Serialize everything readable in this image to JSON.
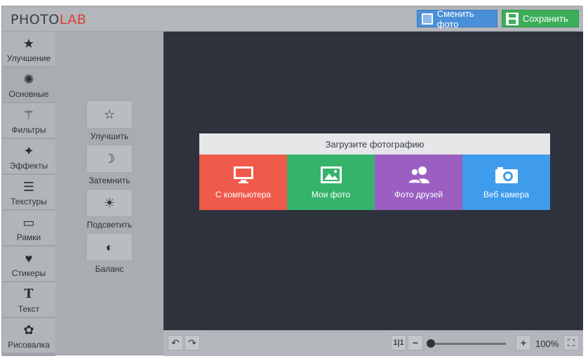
{
  "header": {
    "logo_photo": "PHOTO",
    "logo_lab": "LAB",
    "change_photo_label": "Сменить фото",
    "save_label": "Сохранить"
  },
  "sidebar": {
    "items": [
      {
        "label": "Улучшение",
        "icon": "star-icon"
      },
      {
        "label": "Основные",
        "icon": "aperture-icon"
      },
      {
        "label": "Фильтры",
        "icon": "magic-wand-icon"
      },
      {
        "label": "Эффекты",
        "icon": "sparkles-icon"
      },
      {
        "label": "Текстуры",
        "icon": "layers-icon"
      },
      {
        "label": "Рамки",
        "icon": "frame-icon"
      },
      {
        "label": "Стикеры",
        "icon": "heart-icon"
      },
      {
        "label": "Текст",
        "icon": "text-icon"
      },
      {
        "label": "Рисовалка",
        "icon": "palette-icon"
      }
    ]
  },
  "tools": [
    {
      "label": "Улучшить",
      "icon": "star-outline-icon"
    },
    {
      "label": "Затемнить",
      "icon": "moon-icon"
    },
    {
      "label": "Подсветить",
      "icon": "sun-icon"
    },
    {
      "label": "Баланс",
      "icon": "balance-icon"
    }
  ],
  "upload": {
    "title": "Загрузите фотографию",
    "options": [
      {
        "label": "С компьютера",
        "icon": "monitor-icon",
        "color": "#ef5a4b"
      },
      {
        "label": "Мои фото",
        "icon": "image-icon",
        "color": "#36b36b"
      },
      {
        "label": "Фото друзей",
        "icon": "friends-icon",
        "color": "#9b5fc2"
      },
      {
        "label": "Веб камера",
        "icon": "camera-icon",
        "color": "#3f9bec"
      }
    ]
  },
  "bottom": {
    "ratio_label": "1|1",
    "zoom_level": "100%"
  }
}
